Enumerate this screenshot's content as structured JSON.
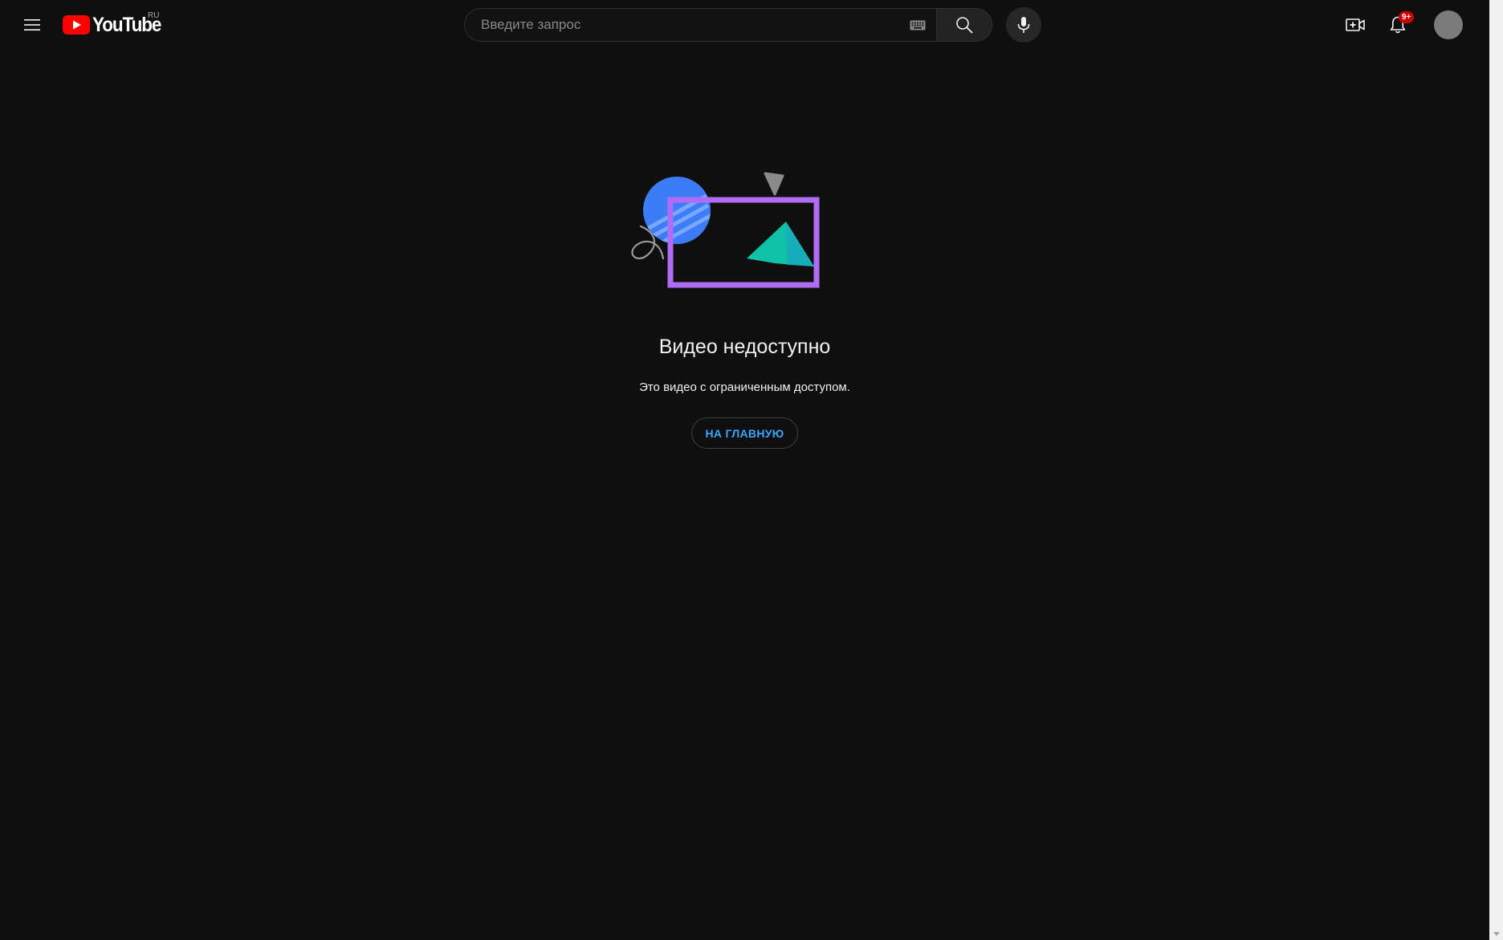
{
  "header": {
    "logo_text": "YouTube",
    "country_code": "RU",
    "search_placeholder": "Введите запрос",
    "notification_count": "9+"
  },
  "icons": {
    "menu": "hamburger-menu-icon",
    "logo": "youtube-play-icon",
    "keyboard": "keyboard-icon",
    "search": "search-icon",
    "mic": "microphone-icon",
    "create": "video-plus-icon",
    "notifications": "bell-icon"
  },
  "main": {
    "title": "Видео недоступно",
    "subtitle": "Это видео с ограниченным доступом.",
    "home_button": "НА ГЛАВНУЮ"
  },
  "colors": {
    "background": "#0f0f0f",
    "logo_red": "#ff0000",
    "link_blue": "#3ea6ff",
    "badge_red": "#cc0000",
    "illustration_blue": "#3d7cf7",
    "illustration_purple": "#b16cf5",
    "illustration_teal": "#0fc2a5"
  }
}
